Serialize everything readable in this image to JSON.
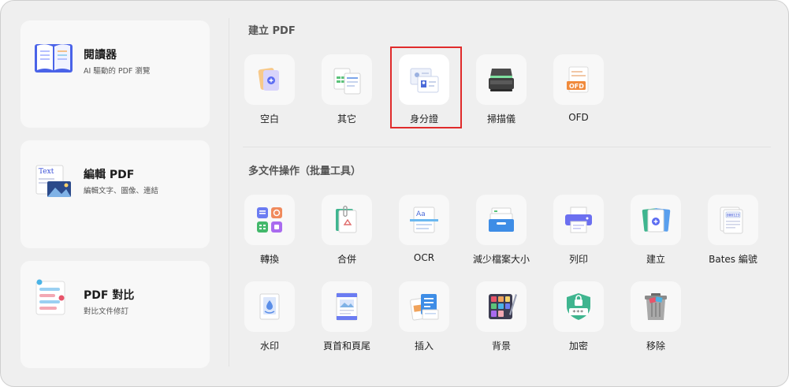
{
  "left_cards": [
    {
      "title": "閱讀器",
      "desc": "AI 驅動的 PDF 瀏覽",
      "icon": "book-icon"
    },
    {
      "title": "編輯 PDF",
      "desc": "編輯文字、圖像、連結",
      "icon": "edit-text-icon",
      "icon_text": "Text"
    },
    {
      "title": "PDF 對比",
      "desc": "對比文件修訂",
      "icon": "compare-icon"
    }
  ],
  "create_section": {
    "title": "建立 PDF",
    "tools": [
      {
        "label": "空白",
        "icon": "blank-pdf-icon"
      },
      {
        "label": "其它",
        "icon": "other-files-icon"
      },
      {
        "label": "身分證",
        "icon": "id-card-icon",
        "selected": true
      },
      {
        "label": "掃描儀",
        "icon": "scanner-icon"
      },
      {
        "label": "OFD",
        "icon": "ofd-icon",
        "icon_text": "OFD"
      }
    ]
  },
  "batch_section": {
    "title": "多文件操作（批量工具）",
    "tools": [
      {
        "label": "轉換",
        "icon": "convert-icon"
      },
      {
        "label": "合併",
        "icon": "merge-icon"
      },
      {
        "label": "OCR",
        "icon": "ocr-icon",
        "icon_text": "Aa"
      },
      {
        "label": "減少檔案大小",
        "icon": "compress-icon"
      },
      {
        "label": "列印",
        "icon": "printer-icon"
      },
      {
        "label": "建立",
        "icon": "create-icon"
      },
      {
        "label": "Bates 編號",
        "icon": "bates-icon",
        "icon_text": "000123"
      },
      {
        "label": "水印",
        "icon": "watermark-icon"
      },
      {
        "label": "頁首和頁尾",
        "icon": "header-footer-icon"
      },
      {
        "label": "插入",
        "icon": "insert-icon"
      },
      {
        "label": "背景",
        "icon": "background-icon"
      },
      {
        "label": "加密",
        "icon": "lock-icon",
        "icon_text": "***"
      },
      {
        "label": "移除",
        "icon": "trash-icon"
      }
    ]
  },
  "colors": {
    "accent_red": "#e02b2b",
    "brand_blue": "#5b6cf2"
  }
}
